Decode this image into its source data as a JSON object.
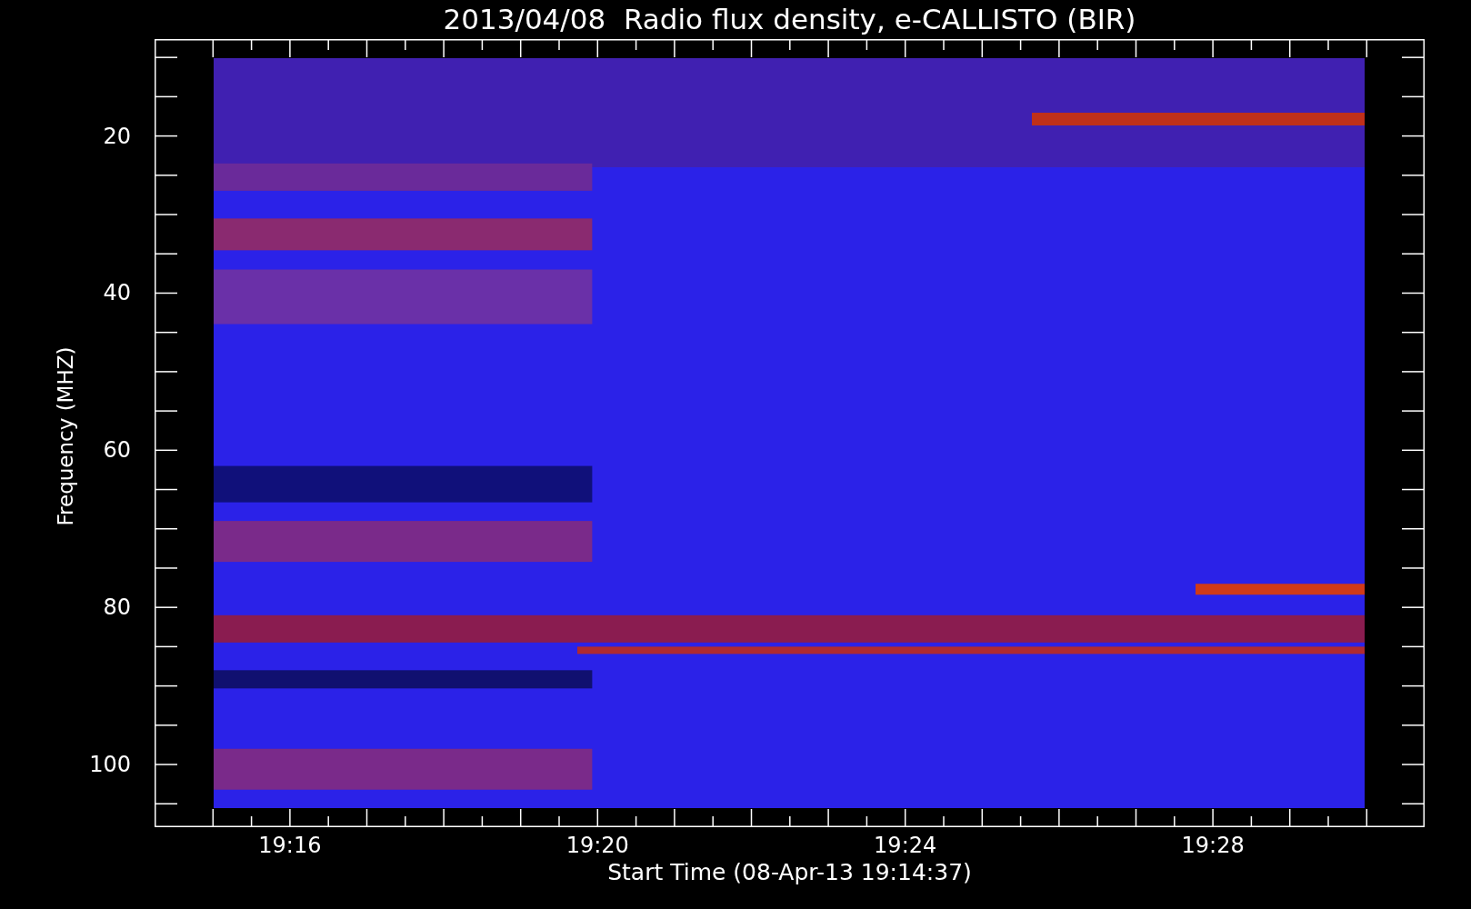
{
  "title": "2013/04/08  Radio flux density, e-CALLISTO (BIR)",
  "y_axis": {
    "label": "Frequency (MHZ)",
    "ticks": [
      "20",
      "40",
      "60",
      "80",
      "100"
    ]
  },
  "x_axis": {
    "label": "Start Time (08-Apr-13 19:14:37)",
    "ticks": [
      "19:16",
      "19:20",
      "19:24",
      "19:28"
    ]
  }
}
